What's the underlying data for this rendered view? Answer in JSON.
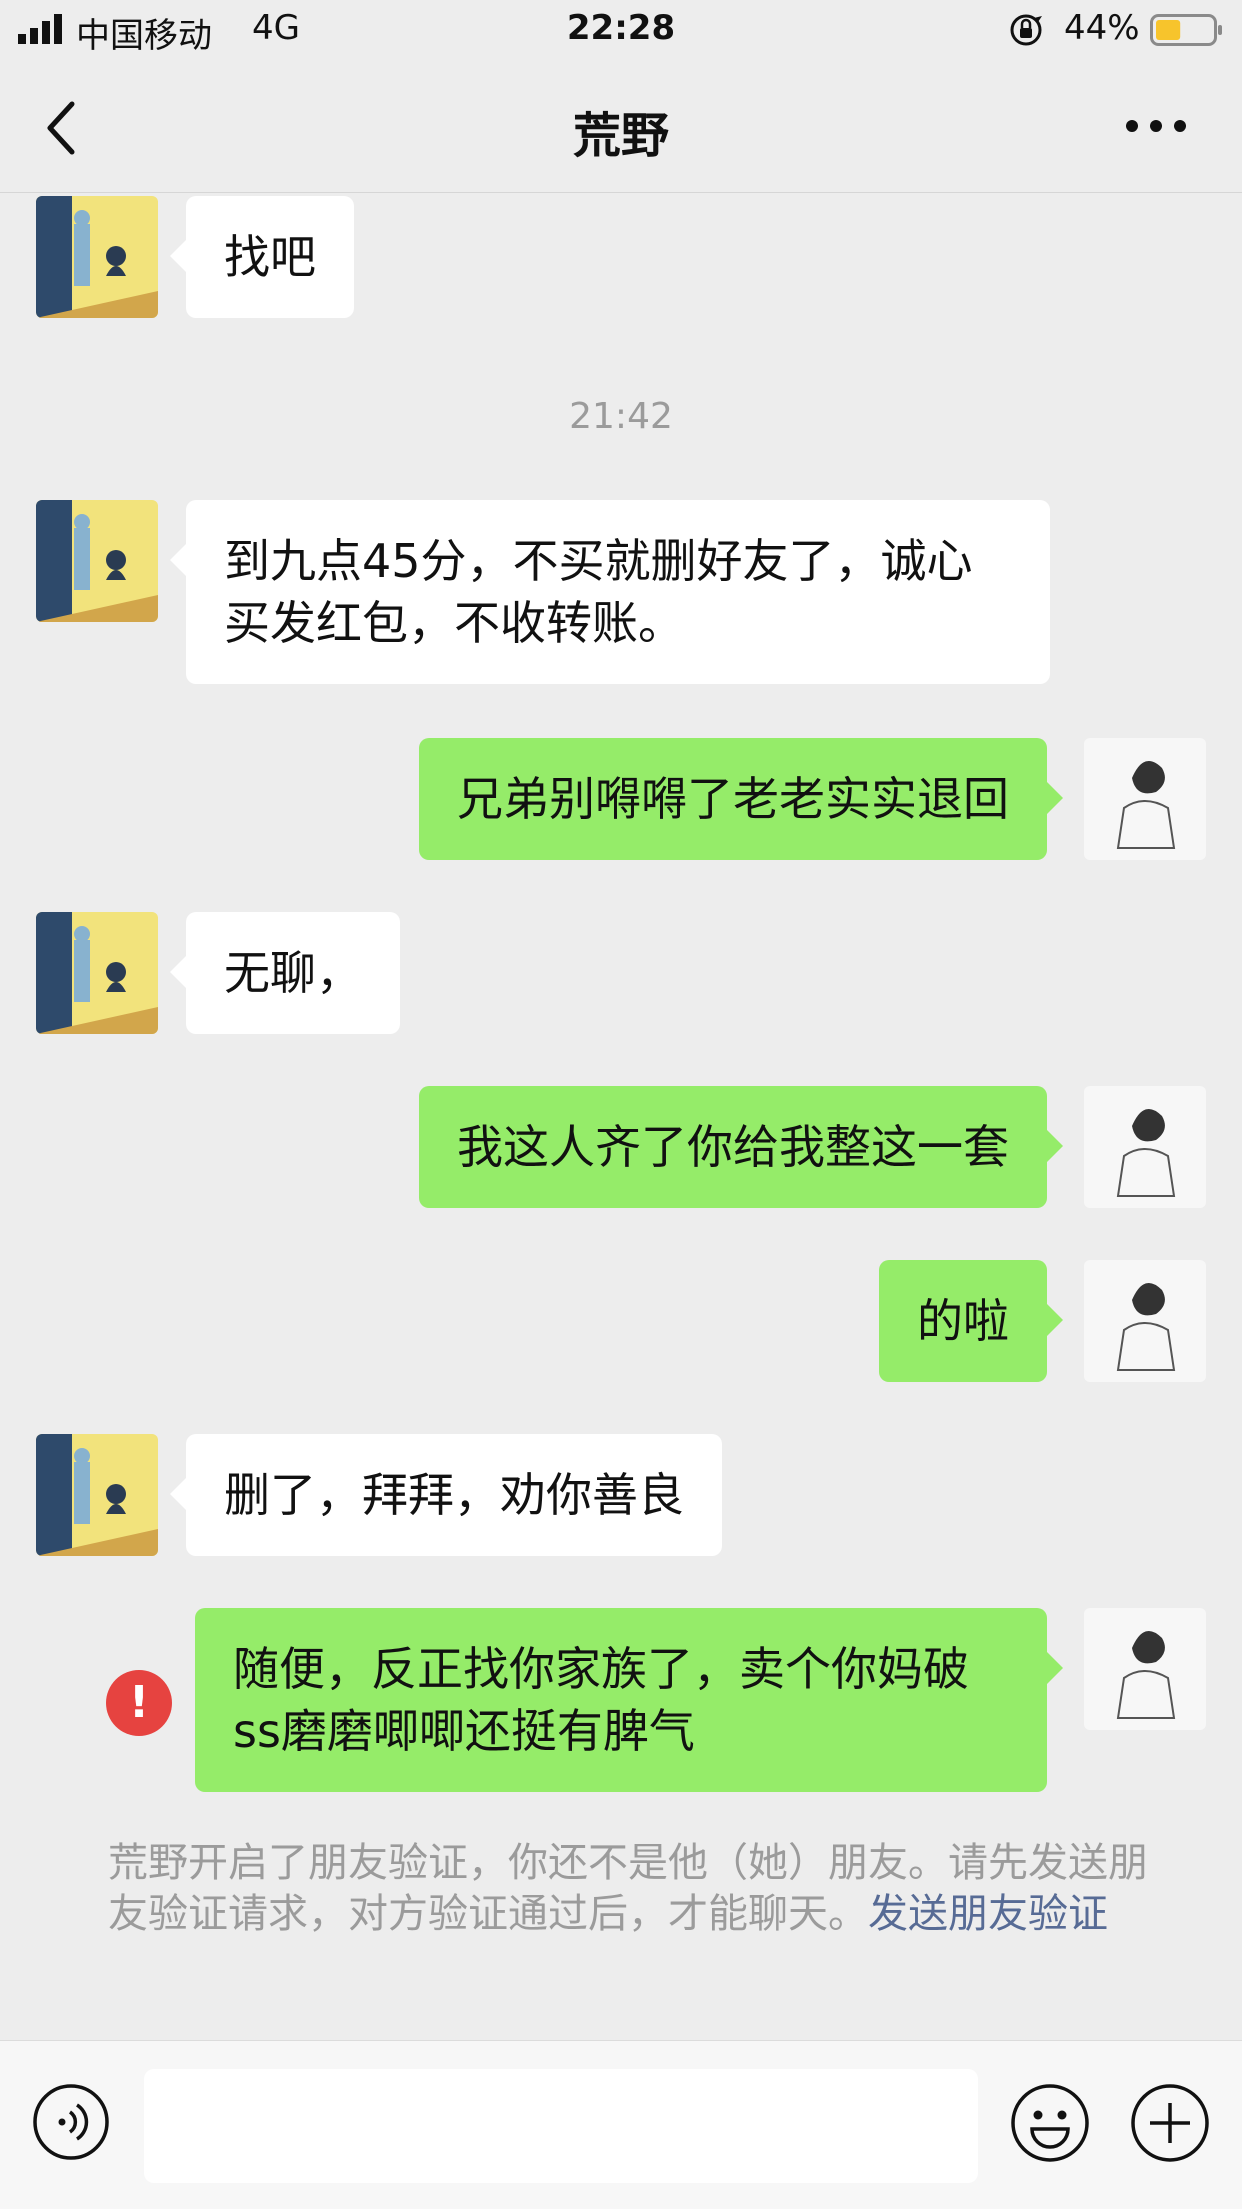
{
  "status_bar": {
    "carrier": "中国移动",
    "network": "4G",
    "time": "22:28",
    "battery_percent": "44%",
    "battery_level": 0.44,
    "icons": [
      "signal-icon",
      "orientation-lock-icon",
      "battery-icon"
    ]
  },
  "nav": {
    "title": "荒野",
    "back_icon": "chevron-left-icon",
    "more_icon": "more-icon"
  },
  "messages": [
    {
      "side": "in",
      "text": "找吧"
    },
    {
      "timestamp": "21:42"
    },
    {
      "side": "in",
      "text": "到九点45分，不买就删好友了，诚心买发红包，不收转账。"
    },
    {
      "side": "out",
      "text": "兄弟别嘚嘚了老老实实退回"
    },
    {
      "side": "in",
      "text": "无聊，"
    },
    {
      "side": "out",
      "text": "我这人齐了你给我整这一套"
    },
    {
      "side": "out",
      "text": "的啦"
    },
    {
      "side": "in",
      "text": "删了，拜拜，劝你善良"
    },
    {
      "side": "out",
      "text": "随便，反正找你家族了，卖个你妈破ss磨磨唧唧还挺有脾气",
      "status": "failed",
      "status_icon": "!"
    }
  ],
  "system_notice": {
    "text": "荒野开启了朋友验证，你还不是他（她）朋友。请先发送朋友验证请求，对方验证通过后，才能聊天。",
    "link": "发送朋友验证"
  },
  "input_bar": {
    "voice_icon": "voice-icon",
    "input_value": "",
    "emoji_icon": "emoji-icon",
    "plus_icon": "plus-icon"
  },
  "colors": {
    "background": "#ededed",
    "outgoing_bubble": "#95ec69",
    "incoming_bubble": "#ffffff",
    "link": "#576b95",
    "error": "#e64340",
    "battery": "#f7c42c"
  }
}
